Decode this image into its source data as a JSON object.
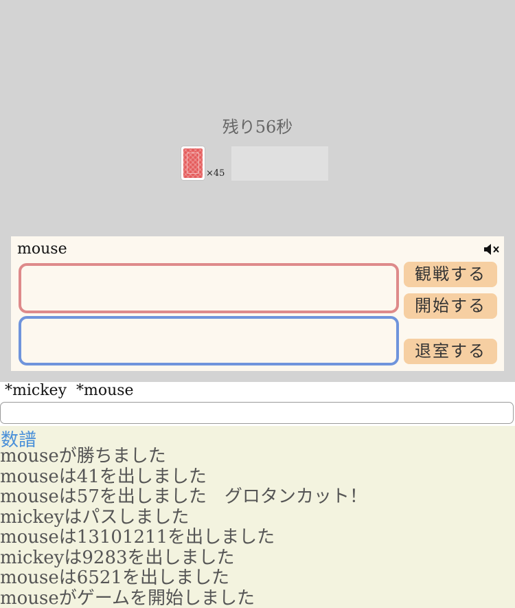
{
  "game": {
    "timer": "残り56秒",
    "deck_count": "×45"
  },
  "panel": {
    "player_name": "mouse",
    "mute_icon": "speaker-muted-icon",
    "buttons": {
      "watch": "観戦する",
      "start": "開始する",
      "leave": "退室する"
    },
    "colors": {
      "top_hand_border": "#de8a8a",
      "bottom_hand_border": "#6f94dc",
      "button_bg": "#f6cfa2"
    }
  },
  "players_line": "*mickey  *mouse",
  "chat": {
    "value": "",
    "placeholder": ""
  },
  "log": {
    "title": "数譜",
    "entries": [
      "mouseが勝ちました",
      "mouseは41を出しました",
      "mouseは57を出しました　グロタンカット！",
      "mickeyはパスしました",
      "mouseは13101211を出しました",
      "mickeyは9283を出しました",
      "mouseは6521を出しました",
      "mouseがゲームを開始しました"
    ]
  }
}
